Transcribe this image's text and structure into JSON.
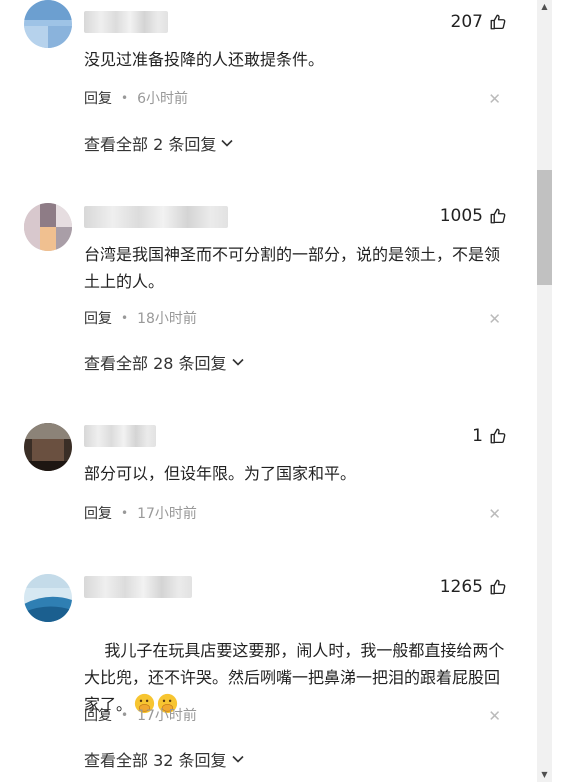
{
  "comments": [
    {
      "likes": "207",
      "text": "没见过准备投降的人还敢提条件。",
      "reply_label": "回复",
      "time": "6小时前",
      "view_replies": "查看全部 2 条回复"
    },
    {
      "likes": "1005",
      "text": "台湾是我国神圣而不可分割的一部分，说的是领土，不是领土上的人。",
      "reply_label": "回复",
      "time": "18小时前",
      "view_replies": "查看全部 28 条回复"
    },
    {
      "likes": "1",
      "text": "部分可以，但设年限。为了国家和平。",
      "reply_label": "回复",
      "time": "17小时前"
    },
    {
      "likes": "1265",
      "text": "我儿子在玩具店要这要那，闹人时，我一般都直接给两个大比兜，还不许哭。然后咧嘴一把鼻涕一把泪的跟着屁股回家了。",
      "reply_label": "回复",
      "time": "17小时前",
      "view_replies": "查看全部 32 条回复"
    }
  ],
  "icons": {
    "like": "thumbs-up-icon",
    "close": "close-icon",
    "chevron": "chevron-down-icon",
    "emoji": "hand-over-mouth-emoji-icon"
  }
}
